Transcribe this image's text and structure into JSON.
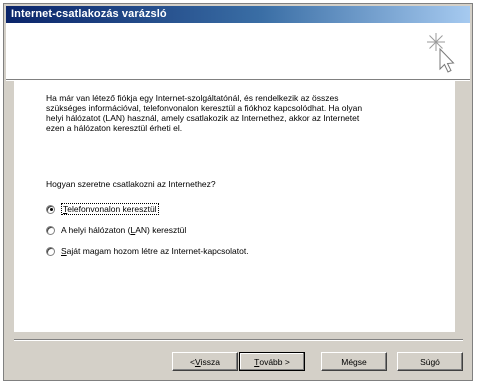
{
  "window": {
    "title": "Internet-csatlakozás varázsló"
  },
  "header": {
    "icon": "wizard-cursor-sparkle-icon"
  },
  "content": {
    "intro_text": "Ha már van létező fiókja egy Internet-szolgáltatónál, és rendelkezik az összes\nszükséges információval, telefonvonalon keresztül a fiókhoz kapcsolódhat. Ha olyan\nhelyi hálózatot (LAN) használ, amely csatlakozik az  Internethez, akkor az Internetet\nezen a hálózaton keresztül érheti el.",
    "question": "Hogyan szeretne csatlakozni az Internethez?",
    "options": [
      {
        "label_before": "",
        "accel": "T",
        "label_after": "elefonvonalon keresztül",
        "selected": true
      },
      {
        "label_before": "A helyi hálózaton (",
        "accel": "L",
        "label_after": "AN) keresztül",
        "selected": false
      },
      {
        "label_before": "",
        "accel": "S",
        "label_after": "aját magam hozom létre az Internet-kapcsolatot.",
        "selected": false
      }
    ]
  },
  "buttons": {
    "back": {
      "prefix": "< ",
      "accel": "V",
      "rest": "issza"
    },
    "next": {
      "prefix": "",
      "accel": "T",
      "rest": "ovább >"
    },
    "cancel": {
      "text": "Mégse"
    },
    "help": {
      "text": "Súgó"
    }
  }
}
